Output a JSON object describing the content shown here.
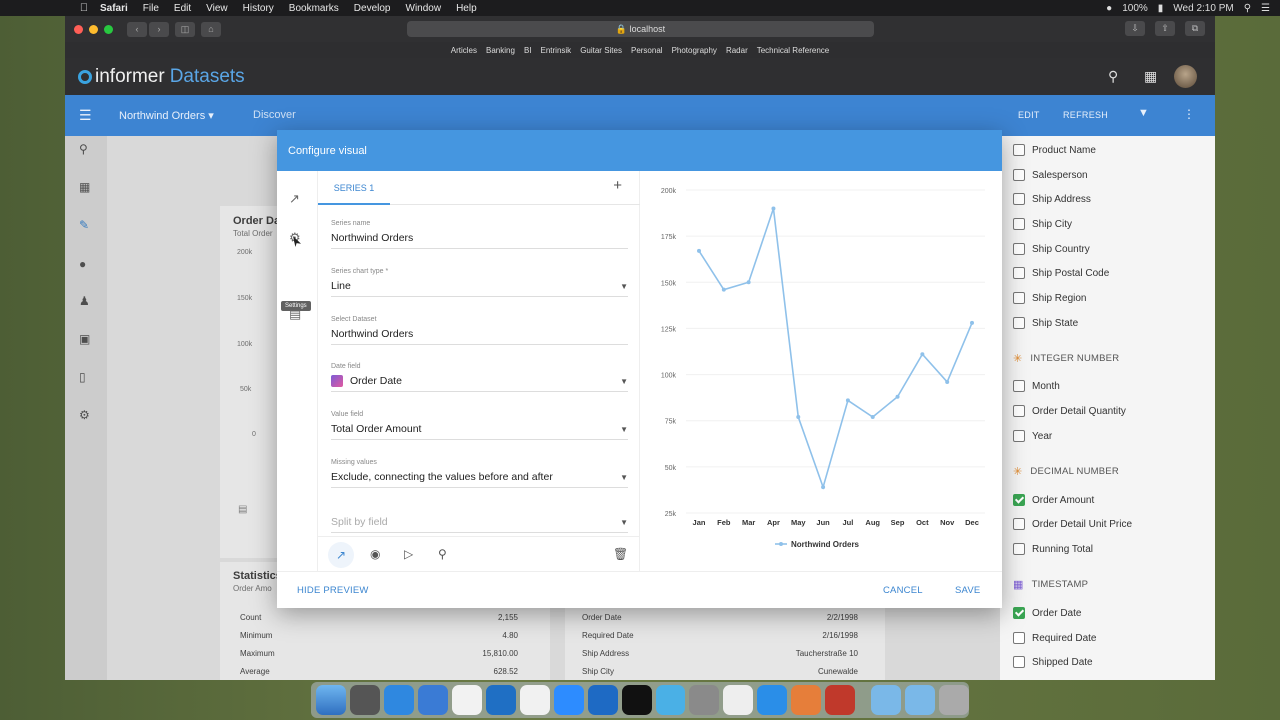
{
  "menubar": {
    "app": "Safari",
    "items": [
      "File",
      "Edit",
      "View",
      "History",
      "Bookmarks",
      "Develop",
      "Window",
      "Help"
    ],
    "battery": "100%",
    "clock": "Wed 2:10 PM"
  },
  "browser": {
    "url": "localhost",
    "favorites": [
      "Articles",
      "Banking",
      "BI",
      "Entrinsik",
      "Guitar Sites",
      "Personal",
      "Photography",
      "Radar",
      "Technical Reference"
    ]
  },
  "app": {
    "logo_text": "informer",
    "logo_section": "Datasets",
    "breadcrumb": "Northwind Orders",
    "breadcrumb_page": "Discover",
    "edit_label": "EDIT",
    "refresh_label": "REFRESH"
  },
  "background": {
    "card1_title": "Order Da",
    "card1_sub": "Total Order",
    "card1_ticks": [
      "200k",
      "150k",
      "100k",
      "50k",
      "0"
    ],
    "stats_title": "Statistics",
    "stats_sub": "Order Amo",
    "stats": [
      {
        "label": "Count",
        "value": "2,155"
      },
      {
        "label": "Minimum",
        "value": "4.80"
      },
      {
        "label": "Maximum",
        "value": "15,810.00"
      },
      {
        "label": "Average",
        "value": "628.52"
      }
    ],
    "record": [
      {
        "label": "Order Date",
        "value": "2/2/1998"
      },
      {
        "label": "Required Date",
        "value": "2/16/1998"
      },
      {
        "label": "Ship Address",
        "value": "Taucherstraße 10"
      },
      {
        "label": "Ship City",
        "value": "Cunewalde"
      }
    ]
  },
  "fields": {
    "text_fields": [
      {
        "label": "Product Name",
        "checked": false
      },
      {
        "label": "Salesperson",
        "checked": false
      },
      {
        "label": "Ship Address",
        "checked": false
      },
      {
        "label": "Ship City",
        "checked": false
      },
      {
        "label": "Ship Country",
        "checked": false
      },
      {
        "label": "Ship Postal Code",
        "checked": false
      },
      {
        "label": "Ship Region",
        "checked": false
      },
      {
        "label": "Ship State",
        "checked": false
      }
    ],
    "integer_group": "INTEGER NUMBER",
    "integer_fields": [
      {
        "label": "Month",
        "checked": false
      },
      {
        "label": "Order Detail Quantity",
        "checked": false
      },
      {
        "label": "Year",
        "checked": false
      }
    ],
    "decimal_group": "DECIMAL NUMBER",
    "decimal_fields": [
      {
        "label": "Order Amount",
        "checked": true
      },
      {
        "label": "Order Detail Unit Price",
        "checked": false
      },
      {
        "label": "Running Total",
        "checked": false
      }
    ],
    "timestamp_group": "TIMESTAMP",
    "timestamp_fields": [
      {
        "label": "Order Date",
        "checked": true
      },
      {
        "label": "Required Date",
        "checked": false
      },
      {
        "label": "Shipped Date",
        "checked": false
      }
    ]
  },
  "modal": {
    "title": "Configure visual",
    "tooltip": "Settings",
    "tab": "SERIES 1",
    "add_icon": "+",
    "fields": {
      "series_name_label": "Series name",
      "series_name_value": "Northwind Orders",
      "chart_type_label": "Series chart type *",
      "chart_type_value": "Line",
      "dataset_label": "Select Dataset",
      "dataset_value": "Northwind Orders",
      "date_label": "Date field",
      "date_value": "Order Date",
      "value_label": "Value field",
      "value_value": "Total Order Amount",
      "missing_label": "Missing values",
      "missing_value": "Exclude, connecting the values before and after",
      "split_placeholder": "Split by field"
    },
    "hide_preview": "HIDE PREVIEW",
    "cancel": "CANCEL",
    "save": "SAVE"
  },
  "colors": {
    "accent": "#4596e0",
    "series": "#8fc1ea",
    "checked": "#3aa553"
  },
  "chart_data": {
    "type": "line",
    "categories": [
      "Jan",
      "Feb",
      "Mar",
      "Apr",
      "May",
      "Jun",
      "Jul",
      "Aug",
      "Sep",
      "Oct",
      "Nov",
      "Dec"
    ],
    "series": [
      {
        "name": "Northwind Orders",
        "values": [
          167000,
          146000,
          150000,
          190000,
          77000,
          39000,
          86000,
          77000,
          88000,
          111000,
          96000,
          128000
        ]
      }
    ],
    "yticks": [
      "25k",
      "50k",
      "75k",
      "100k",
      "125k",
      "150k",
      "175k",
      "200k"
    ],
    "ylim": [
      25000,
      200000
    ],
    "grid": true,
    "legend": "bottom"
  }
}
